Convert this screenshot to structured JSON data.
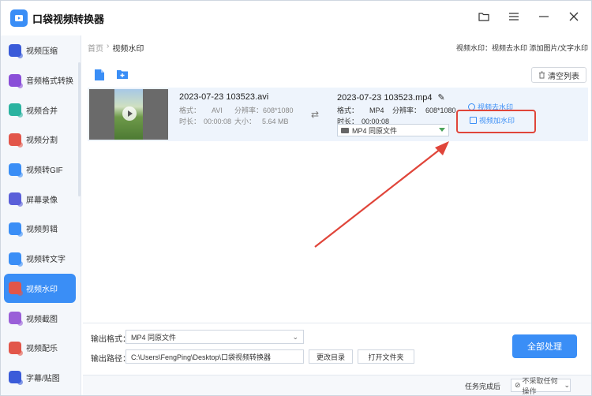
{
  "app": {
    "title": "口袋视频转换器"
  },
  "sidebar": {
    "items": [
      {
        "label": "视频压缩",
        "color": "#3a5bd9"
      },
      {
        "label": "音频格式转换",
        "color": "#8a4fd8"
      },
      {
        "label": "视频合并",
        "color": "#2bb3a0"
      },
      {
        "label": "视频分割",
        "color": "#e2564a"
      },
      {
        "label": "视频转GIF",
        "color": "#3a8ef6"
      },
      {
        "label": "屏幕录像",
        "color": "#5a5fd9"
      },
      {
        "label": "视频剪辑",
        "color": "#3a8ef6"
      },
      {
        "label": "视频转文字",
        "color": "#3a8ef6"
      },
      {
        "label": "视频水印",
        "color": "#e2564a"
      },
      {
        "label": "视频截图",
        "color": "#9a5fd8"
      },
      {
        "label": "视频配乐",
        "color": "#e2564a"
      },
      {
        "label": "字幕/贴图",
        "color": "#3a5bd9"
      }
    ],
    "active_index": 8
  },
  "breadcrumb": {
    "home": "首页",
    "sep": "›",
    "current": "视频水印"
  },
  "top_right": "视频水印：视频去水印 添加图片/文字水印",
  "toolbar": {
    "clear_label": "清空列表"
  },
  "file": {
    "source_name": "2023-07-23 103523.avi",
    "format_label": "格式：",
    "format_value": "AVI",
    "resolution_label": "分辨率：",
    "resolution_value": "608*1080",
    "duration_label": "时长：",
    "duration_value": "00:00:08",
    "size_label": "大小：",
    "size_value": "5.64 MB",
    "dest_name": "2023-07-23 103523.mp4",
    "dest_format_value": "MP4",
    "dest_resolution_value": "608*1080",
    "dest_duration_value": "00:00:08",
    "output_select": "MP4  同原文件",
    "remove_watermark": "视频去水印",
    "add_watermark": "视频加水印"
  },
  "bottom": {
    "format_label": "输出格式：",
    "format_value": "MP4  同原文件",
    "path_label": "输出路径：",
    "path_value": "C:\\Users\\FengPing\\Desktop\\口袋视频转换器",
    "change_dir": "更改目录",
    "open_folder": "打开文件夹",
    "process_all": "全部处理"
  },
  "status": {
    "label": "任务完成后",
    "value": "不采取任何操作"
  },
  "colors": {
    "accent": "#3a8ef6",
    "highlight": "#e0453a"
  }
}
